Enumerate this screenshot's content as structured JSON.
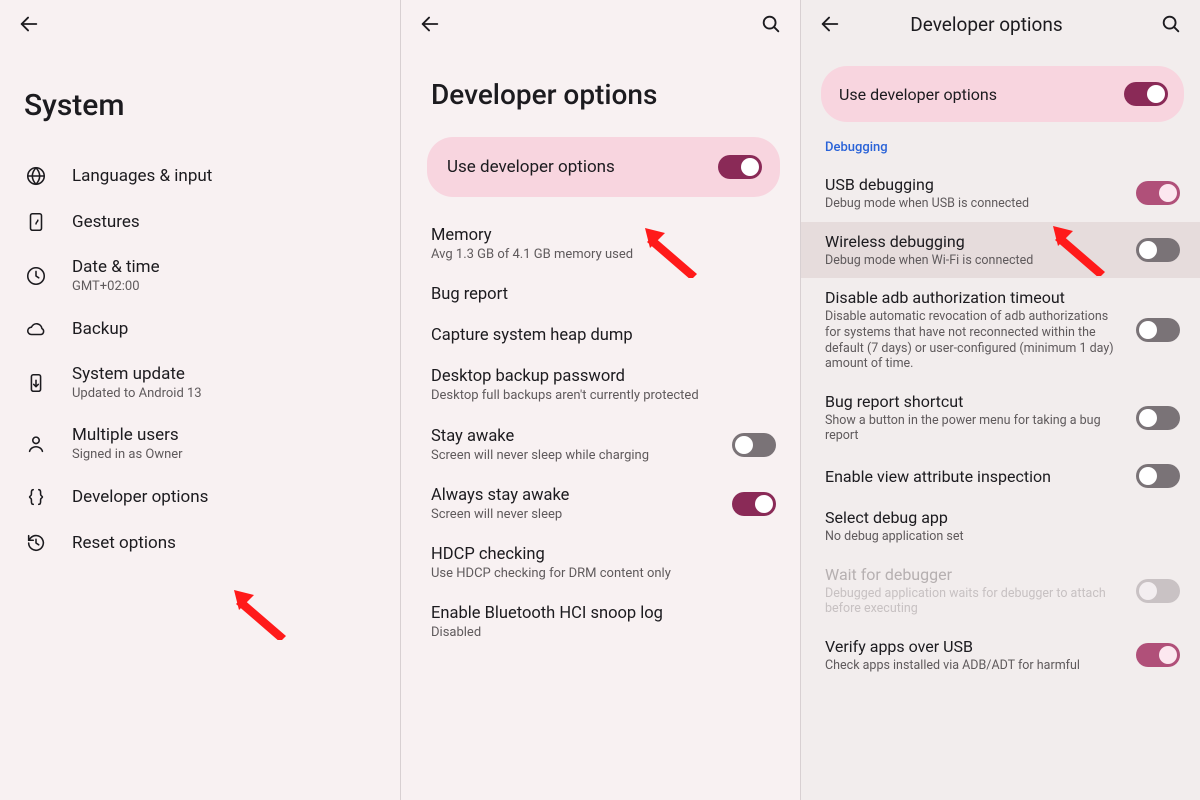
{
  "panel1": {
    "title": "System",
    "items": [
      {
        "icon": "globe",
        "title": "Languages & input",
        "sub": ""
      },
      {
        "icon": "gesture",
        "title": "Gestures",
        "sub": ""
      },
      {
        "icon": "clock",
        "title": "Date & time",
        "sub": "GMT+02:00"
      },
      {
        "icon": "cloud",
        "title": "Backup",
        "sub": ""
      },
      {
        "icon": "device-update",
        "title": "System update",
        "sub": "Updated to Android 13"
      },
      {
        "icon": "person",
        "title": "Multiple users",
        "sub": "Signed in as Owner"
      },
      {
        "icon": "braces",
        "title": "Developer options",
        "sub": ""
      },
      {
        "icon": "history",
        "title": "Reset options",
        "sub": ""
      }
    ]
  },
  "panel2": {
    "title": "Developer options",
    "master_toggle": "Use developer options",
    "items": [
      {
        "title": "Memory",
        "sub": "Avg 1.3 GB of 4.1 GB memory used",
        "toggle": null
      },
      {
        "title": "Bug report",
        "sub": "",
        "toggle": null
      },
      {
        "title": "Capture system heap dump",
        "sub": "",
        "toggle": null
      },
      {
        "title": "Desktop backup password",
        "sub": "Desktop full backups aren't currently protected",
        "toggle": null
      },
      {
        "title": "Stay awake",
        "sub": "Screen will never sleep while charging",
        "toggle": "off"
      },
      {
        "title": "Always stay awake",
        "sub": "Screen will never sleep",
        "toggle": "on"
      },
      {
        "title": "HDCP checking",
        "sub": "Use HDCP checking for DRM content only",
        "toggle": null
      },
      {
        "title": "Enable Bluetooth HCI snoop log",
        "sub": "Disabled",
        "toggle": null
      }
    ]
  },
  "panel3": {
    "title": "Developer options",
    "master_toggle": "Use developer options",
    "section": "Debugging",
    "items": [
      {
        "title": "USB debugging",
        "sub": "Debug mode when USB is connected",
        "toggle": "onpink",
        "highlight": false,
        "dim": false
      },
      {
        "title": "Wireless debugging",
        "sub": "Debug mode when Wi-Fi is connected",
        "toggle": "off",
        "highlight": true,
        "dim": false
      },
      {
        "title": "Disable adb authorization timeout",
        "sub": "Disable automatic revocation of adb authorizations for systems that have not reconnected within the default (7 days) or user-configured (minimum 1 day) amount of time.",
        "toggle": "off",
        "highlight": false,
        "dim": false
      },
      {
        "title": "Bug report shortcut",
        "sub": "Show a button in the power menu for taking a bug report",
        "toggle": "off",
        "highlight": false,
        "dim": false
      },
      {
        "title": "Enable view attribute inspection",
        "sub": "",
        "toggle": "off",
        "highlight": false,
        "dim": false
      },
      {
        "title": "Select debug app",
        "sub": "No debug application set",
        "toggle": null,
        "highlight": false,
        "dim": false
      },
      {
        "title": "Wait for debugger",
        "sub": "Debugged application waits for debugger to attach before executing",
        "toggle": "offlt",
        "highlight": false,
        "dim": true
      },
      {
        "title": "Verify apps over USB",
        "sub": "Check apps installed via ADB/ADT for harmful",
        "toggle": "onpink",
        "highlight": false,
        "dim": false
      }
    ]
  }
}
